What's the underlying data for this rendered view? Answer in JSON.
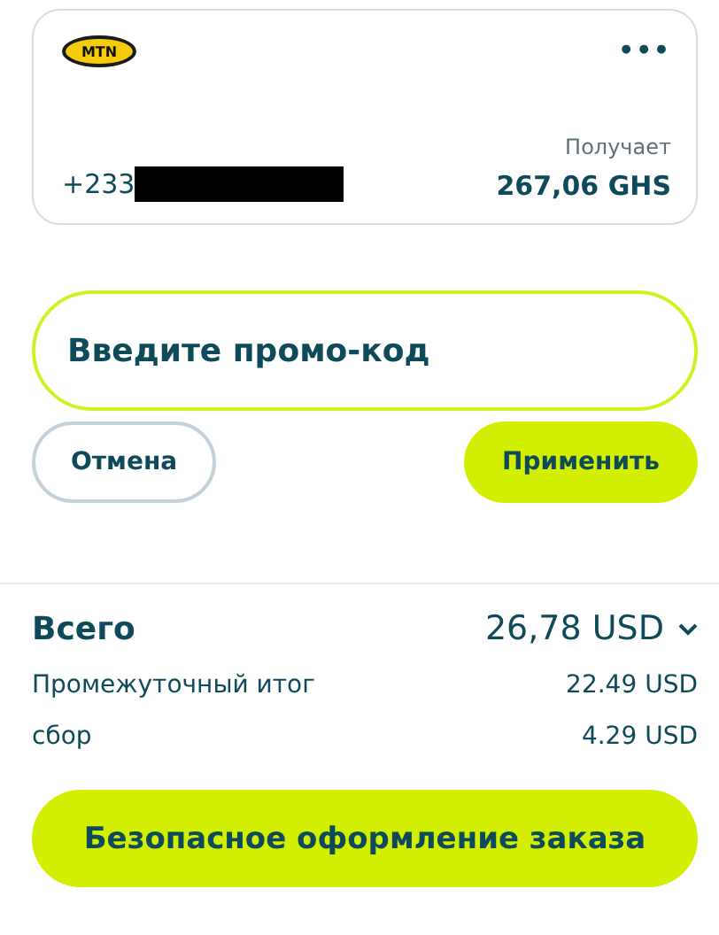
{
  "recipient": {
    "operator_logo": "MTN",
    "phone": "+233",
    "receives_label": "Получает",
    "receives_amount": "267,06 GHS",
    "menu_icon": "•••"
  },
  "promo": {
    "placeholder": "Введите промо-код"
  },
  "buttons": [
    {
      "label": "Отмена",
      "kind": "outline"
    },
    {
      "label": "Применить",
      "kind": "primary"
    }
  ],
  "summary": {
    "total_label": "Всего",
    "total_value": "26,78 USD",
    "expanded": true,
    "rows": [
      {
        "label": "Промежуточный итог",
        "value": "22.49 USD"
      },
      {
        "label": "сбор",
        "value": "4.29 USD"
      }
    ]
  },
  "checkout_button": "Безопасное оформление заказа"
}
